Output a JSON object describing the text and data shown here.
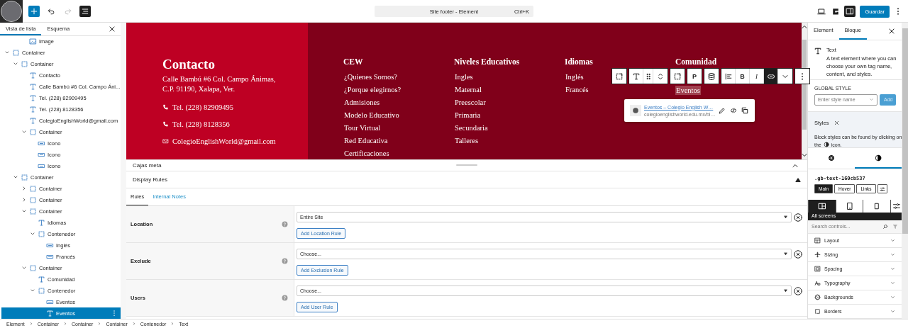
{
  "top_bar": {
    "tools": [
      {
        "kind": "inserter",
        "disabled": false
      },
      {
        "kind": "undo",
        "disabled": false
      },
      {
        "kind": "redo",
        "disabled": true
      },
      {
        "kind": "list-view",
        "selected": true
      }
    ],
    "command": {
      "title": "Site footer - Element",
      "shortcut": "Ctrl+K"
    },
    "actions": [
      {
        "kind": "desktop",
        "selected": false
      },
      {
        "kind": "plugin-logo",
        "selected": false
      },
      {
        "kind": "sidebar",
        "selected": true
      }
    ],
    "save": "Guardar"
  },
  "list_view": {
    "tabs": [
      {
        "label": "Vista de lista",
        "selected": true
      },
      {
        "label": "Esquema",
        "selected": false
      }
    ],
    "partial_item": {
      "kind": "image",
      "label": "Image"
    },
    "tree": [
      {
        "kind": "container",
        "label": "Container",
        "expanded": true,
        "selected": false,
        "children": [
          {
            "kind": "container",
            "label": "Container",
            "expanded": true,
            "selected": false,
            "children": [
              {
                "kind": "text",
                "label": "Contacto",
                "selected": false
              },
              {
                "kind": "text",
                "label": "Calle Bambú #6 Col. Campo Áni...",
                "selected": false
              },
              {
                "kind": "text",
                "label": "Tel. (228) 82909495",
                "selected": false
              },
              {
                "kind": "text",
                "label": "Tel. (228) 8128356",
                "selected": false
              },
              {
                "kind": "text",
                "label": "ColegioEnglishWorld@gmail.com",
                "selected": false
              },
              {
                "kind": "container",
                "label": "Container",
                "expanded": true,
                "selected": false,
                "children": [
                  {
                    "kind": "button",
                    "label": "Icono",
                    "selected": false
                  },
                  {
                    "kind": "button",
                    "label": "Icono",
                    "selected": false
                  },
                  {
                    "kind": "button",
                    "label": "Icono",
                    "selected": false
                  }
                ]
              }
            ]
          },
          {
            "kind": "container",
            "label": "Container",
            "expanded": true,
            "selected": false,
            "children": [
              {
                "kind": "container",
                "label": "Container",
                "expanded": false,
                "selected": false
              },
              {
                "kind": "container",
                "label": "Container",
                "expanded": false,
                "selected": false
              },
              {
                "kind": "container",
                "label": "Container",
                "expanded": true,
                "selected": false,
                "children": [
                  {
                    "kind": "text",
                    "label": "Idiomas",
                    "selected": false
                  },
                  {
                    "kind": "container",
                    "label": "Contenedor",
                    "expanded": true,
                    "selected": false,
                    "children": [
                      {
                        "kind": "button",
                        "label": "Inglés",
                        "selected": false
                      },
                      {
                        "kind": "button",
                        "label": "Francés",
                        "selected": false
                      }
                    ]
                  }
                ]
              },
              {
                "kind": "container",
                "label": "Container",
                "expanded": true,
                "selected": false,
                "children": [
                  {
                    "kind": "text",
                    "label": "Comunidad",
                    "selected": false
                  },
                  {
                    "kind": "container",
                    "label": "Contenedor",
                    "expanded": true,
                    "selected": false,
                    "children": [
                      {
                        "kind": "button",
                        "label": "Eventos",
                        "selected": false
                      },
                      {
                        "kind": "text",
                        "label": "Eventos",
                        "selected": true
                      }
                    ]
                  }
                ]
              }
            ]
          }
        ]
      }
    ]
  },
  "canvas": {
    "contact": {
      "heading": "Contacto",
      "address": [
        "Calle Bambú #6 Col. Campo Ánimas,",
        "C.P. 91190, Xalapa, Ver."
      ],
      "lines": [
        {
          "kind": "phone",
          "text": "Tel. (228) 82909495"
        },
        {
          "kind": "phone",
          "text": "Tel. (228) 8128356"
        },
        {
          "kind": "email",
          "text": "ColegioEnglishWorld@gmail.com"
        }
      ]
    },
    "columns": [
      {
        "heading": "CEW",
        "links": [
          {
            "label": "¿Quienes Somos?",
            "selected": false
          },
          {
            "label": "¿Porque elegirnos?",
            "selected": false
          },
          {
            "label": "Admisiones",
            "selected": false
          },
          {
            "label": "Modelo Educativo",
            "selected": false
          },
          {
            "label": "Tour Virtual",
            "selected": false
          },
          {
            "label": "Red Educativa",
            "selected": false
          },
          {
            "label": "Certificaciones",
            "selected": false
          }
        ]
      },
      {
        "heading": "Niveles Educativos",
        "links": [
          {
            "label": "Ingles",
            "selected": false
          },
          {
            "label": "Maternal",
            "selected": false
          },
          {
            "label": "Preescolar",
            "selected": false
          },
          {
            "label": "Primaria",
            "selected": false
          },
          {
            "label": "Secundaria",
            "selected": false
          },
          {
            "label": "Talleres",
            "selected": false
          }
        ]
      },
      {
        "heading": "Idiomas",
        "links": [
          {
            "label": "Inglés",
            "selected": false
          },
          {
            "label": "Francés",
            "selected": false
          }
        ]
      },
      {
        "heading": "Comunidad",
        "links": [
          {
            "label": "Eventos",
            "selected": true
          }
        ]
      }
    ],
    "block_toolbar": [
      {
        "kind": "parent",
        "active": false
      },
      {
        "kind": "text-type",
        "active": false
      },
      {
        "kind": "drag",
        "active": false
      },
      {
        "kind": "move",
        "active": false
      },
      {
        "kind": "container-select",
        "active": false
      },
      {
        "kind": "tag",
        "label": "P",
        "active": false
      },
      {
        "kind": "dynamic-data",
        "active": false
      },
      {
        "kind": "align",
        "active": false
      },
      {
        "kind": "bold",
        "label": "B",
        "active": false
      },
      {
        "kind": "italic",
        "label": "I",
        "active": false
      },
      {
        "kind": "link",
        "active": true
      },
      {
        "kind": "more",
        "active": false
      },
      {
        "kind": "options",
        "active": false
      }
    ],
    "link_popover": {
      "title": "Eventos – Colegio English W…",
      "url": "colegioenglishworld.edu.mx/bl…"
    }
  },
  "meta_boxes": {
    "title": "Cajas meta",
    "expanded": true
  },
  "display_rules": {
    "title": "Display Rules",
    "expanded": true,
    "tabs": [
      {
        "label": "Rules",
        "selected": true
      },
      {
        "label": "Internal Notes",
        "selected": false
      }
    ],
    "rules": [
      {
        "label": "Location",
        "value": "Entire Site",
        "button": "Add Location Rule"
      },
      {
        "label": "Exclude",
        "value": "Choose...",
        "button": "Add Exclusion Rule"
      },
      {
        "label": "Users",
        "value": "Choose...",
        "button": "Add User Rule"
      }
    ]
  },
  "inspector": {
    "tabs": [
      {
        "label": "Element",
        "selected": false
      },
      {
        "label": "Bloque",
        "selected": true
      }
    ],
    "block": {
      "name": "Text",
      "description": "A text element where you can choose your own tag name, content, and styles."
    },
    "global_style": {
      "label": "GLOBAL STYLE",
      "placeholder": "Enter style name",
      "button": "Add",
      "disabled": true
    },
    "notice": {
      "title": "Styles",
      "line1": "Block styles can be found by clicking on",
      "line2": "the",
      "after": "icon."
    },
    "panel_tabs": [
      {
        "kind": "settings",
        "selected": false
      },
      {
        "kind": "styles",
        "selected": true
      }
    ],
    "selector": ".gb-text-160cb537",
    "states": [
      {
        "label": "Main",
        "selected": true
      },
      {
        "label": "Hover",
        "selected": false
      },
      {
        "label": "Links",
        "selected": false
      }
    ],
    "devices": [
      {
        "kind": "desktop",
        "selected": true
      },
      {
        "kind": "tablet",
        "selected": false
      },
      {
        "kind": "mobile",
        "selected": false
      }
    ],
    "device_label": "All screens",
    "search": {
      "placeholder": "Search controls..."
    },
    "panels": [
      {
        "kind": "layout",
        "label": "Layout"
      },
      {
        "kind": "sizing",
        "label": "Sizing"
      },
      {
        "kind": "spacing",
        "label": "Spacing"
      },
      {
        "kind": "typography",
        "label": "Typography"
      },
      {
        "kind": "backgrounds",
        "label": "Backgrounds"
      },
      {
        "kind": "borders",
        "label": "Borders"
      }
    ]
  },
  "breadcrumb": [
    "Element",
    "Container",
    "Container",
    "Container",
    "Contenedor",
    "Text"
  ]
}
